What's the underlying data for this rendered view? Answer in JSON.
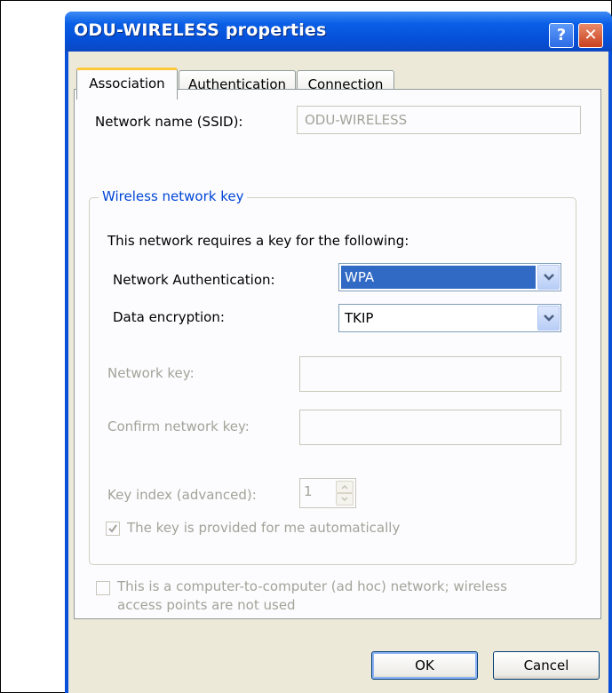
{
  "window": {
    "title": "ODU-WIRELESS properties",
    "help_glyph": "?",
    "close_glyph": "✕"
  },
  "tabs": [
    {
      "label": "Association",
      "active": true
    },
    {
      "label": "Authentication",
      "active": false
    },
    {
      "label": "Connection",
      "active": false
    }
  ],
  "association": {
    "ssid_label": "Network name (SSID):",
    "ssid_value": "ODU-WIRELESS",
    "group_title": "Wireless network key",
    "requires_text": "This network requires a key for the following:",
    "auth_label": "Network Authentication:",
    "auth_value": "WPA",
    "encryption_label": "Data encryption:",
    "encryption_value": "TKIP",
    "network_key_label": "Network key:",
    "network_key_value": "",
    "confirm_key_label": "Confirm network key:",
    "confirm_key_value": "",
    "key_index_label": "Key index (advanced):",
    "key_index_value": "1",
    "auto_key_label": "The key is provided for me automatically",
    "auto_key_checked": true,
    "adhoc_label_line1": "This is a computer-to-computer (ad hoc) network; wireless",
    "adhoc_label_line2": "access points are not used",
    "adhoc_checked": false
  },
  "buttons": {
    "ok": "OK",
    "cancel": "Cancel"
  },
  "colors": {
    "titlebar": "#0550d8",
    "face": "#ece9d8",
    "selection": "#316ac5",
    "group_title": "#0046d5",
    "disabled_text": "#a3a39a"
  }
}
